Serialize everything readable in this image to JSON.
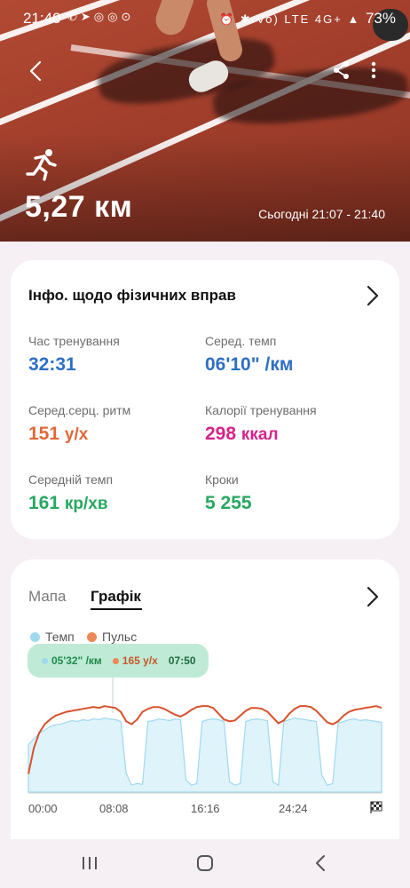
{
  "status_bar": {
    "time": "21:40",
    "network": "Vo) LTE 4G+",
    "battery": "73%"
  },
  "workout": {
    "distance": "5,27 км",
    "date_range": "Сьогодні 21:07 - 21:40"
  },
  "info_card": {
    "title": "Інфо. щодо фізичних вправ",
    "metrics": [
      {
        "label": "Час тренування",
        "value": "32:31",
        "unit": "",
        "color": "#2f6fc4"
      },
      {
        "label": "Серед. темп",
        "value": "06'10\" /км",
        "unit": "",
        "color": "#2f6fc4"
      },
      {
        "label": "Серед.серц. ритм",
        "value": "151",
        "unit": "у/х",
        "color": "#e0693a"
      },
      {
        "label": "Калорії тренування",
        "value": "298",
        "unit": "ккал",
        "color": "#d6238b"
      },
      {
        "label": "Середній темп",
        "value": "161",
        "unit": "кр/хв",
        "color": "#27a85f"
      },
      {
        "label": "Кроки",
        "value": "5 255",
        "unit": "",
        "color": "#27a85f"
      }
    ]
  },
  "graph_card": {
    "tabs": [
      {
        "label": "Мапа",
        "active": false
      },
      {
        "label": "Графік",
        "active": true
      }
    ],
    "legend": [
      {
        "label": "Темп",
        "color": "#9fd9f0"
      },
      {
        "label": "Пульс",
        "color": "#ee8756"
      }
    ],
    "tooltip": {
      "pace": "05'32\" /км",
      "heart_rate": "165 у/х",
      "time": "07:50"
    },
    "x_ticks": [
      "00:00",
      "08:08",
      "16:16",
      "24:24"
    ]
  },
  "chart_data": {
    "type": "area",
    "x_label": "",
    "x_ticks": [
      "00:00",
      "08:08",
      "16:16",
      "24:24"
    ],
    "x_minutes": [
      0,
      0.5,
      1,
      1.5,
      2,
      2.5,
      3,
      3.5,
      4,
      4.5,
      5,
      5.5,
      6,
      6.5,
      7,
      7.5,
      8,
      8.5,
      9,
      9.5,
      10,
      10.5,
      11,
      11.5,
      12,
      12.5,
      13,
      13.5,
      14,
      14.5,
      15,
      15.5,
      16,
      16.5,
      17,
      17.5,
      18,
      18.5,
      19,
      19.5,
      20,
      20.5,
      21,
      21.5,
      22,
      22.5,
      23,
      23.5,
      24,
      24.5,
      25,
      25.5,
      26,
      26.5,
      27,
      27.5,
      28,
      28.5,
      29,
      29.5,
      30,
      30.5,
      31,
      31.5,
      32,
      32.5
    ],
    "series": [
      {
        "name": "Пульс",
        "color": "#d9502c",
        "values": [
          95,
          122,
          138,
          147,
          152,
          156,
          158,
          160,
          161,
          162,
          163,
          164,
          165,
          164,
          166,
          165,
          164,
          160,
          150,
          147,
          152,
          160,
          163,
          165,
          165,
          163,
          160,
          157,
          155,
          158,
          162,
          165,
          166,
          166,
          164,
          158,
          152,
          150,
          151,
          156,
          161,
          164,
          164,
          163,
          160,
          154,
          148,
          151,
          158,
          163,
          166,
          166,
          165,
          161,
          155,
          149,
          147,
          150,
          156,
          160,
          162,
          163,
          164,
          165,
          166,
          164
        ]
      },
      {
        "name": "Темп",
        "color": "#9fd9f0",
        "values": [
          0.55,
          0.62,
          0.68,
          0.72,
          0.76,
          0.78,
          0.79,
          0.81,
          0.83,
          0.82,
          0.84,
          0.83,
          0.85,
          0.84,
          0.86,
          0.85,
          0.84,
          0.82,
          0.22,
          0.08,
          0.1,
          0.09,
          0.82,
          0.83,
          0.85,
          0.84,
          0.83,
          0.85,
          0.84,
          0.14,
          0.08,
          0.1,
          0.82,
          0.84,
          0.85,
          0.84,
          0.82,
          0.12,
          0.08,
          0.1,
          0.82,
          0.84,
          0.85,
          0.84,
          0.83,
          0.12,
          0.08,
          0.82,
          0.84,
          0.86,
          0.85,
          0.84,
          0.83,
          0.82,
          0.2,
          0.08,
          0.1,
          0.8,
          0.82,
          0.84,
          0.85,
          0.83,
          0.84,
          0.83,
          0.82,
          0.81
        ]
      }
    ],
    "hr_range": [
      90,
      180
    ],
    "grid": false
  }
}
